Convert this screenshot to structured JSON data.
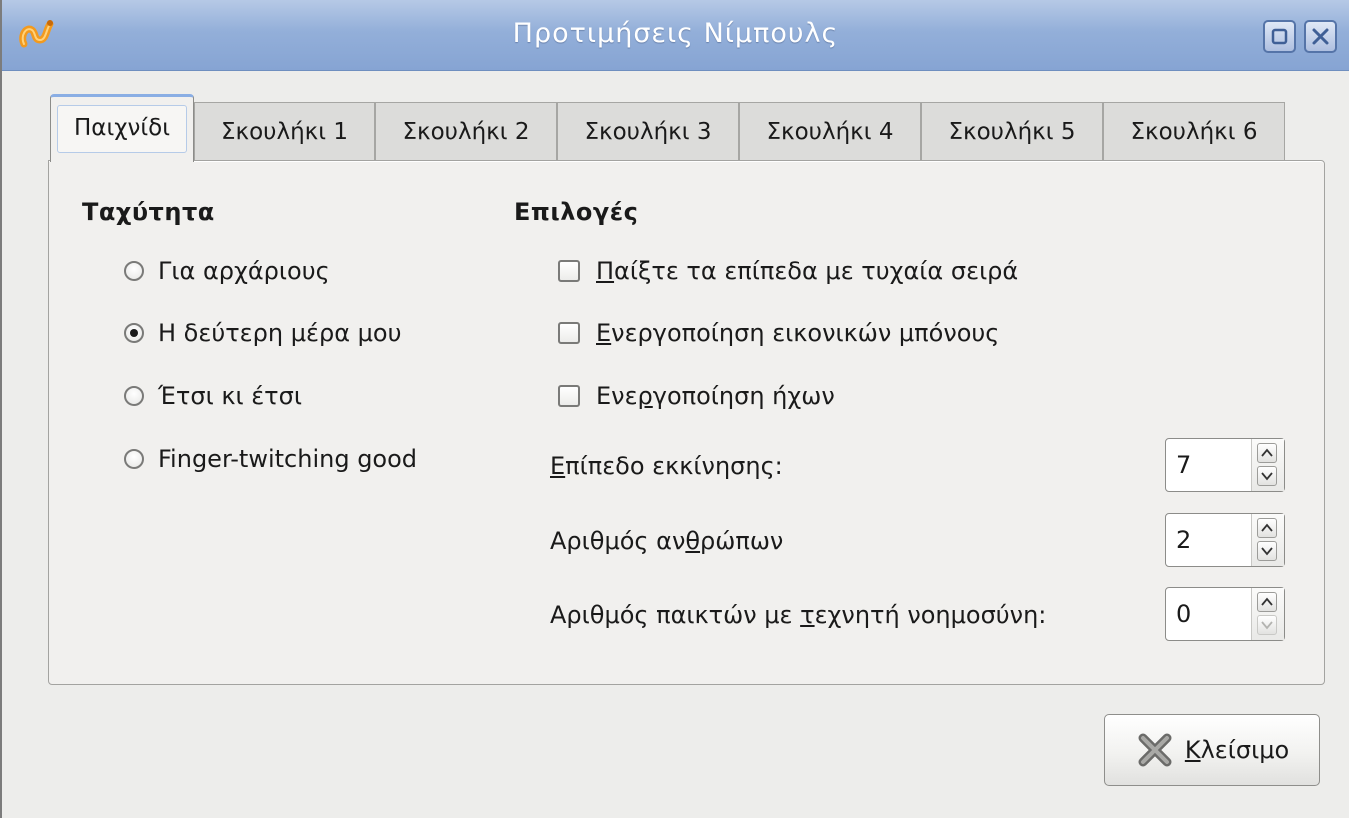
{
  "window": {
    "title": "Προτιμήσεις Νίμπουλς",
    "title_bar_color": "#93afd9"
  },
  "tabs": [
    {
      "label": "Παιχνίδι",
      "active": true
    },
    {
      "label": "Σκουλήκι 1",
      "active": false
    },
    {
      "label": "Σκουλήκι 2",
      "active": false
    },
    {
      "label": "Σκουλήκι 3",
      "active": false
    },
    {
      "label": "Σκουλήκι 4",
      "active": false
    },
    {
      "label": "Σκουλήκι 5",
      "active": false
    },
    {
      "label": "Σκουλήκι 6",
      "active": false
    }
  ],
  "speed": {
    "title": "Ταχύτητα",
    "options": [
      {
        "label": "Για αρχάριους",
        "selected": false
      },
      {
        "label": "Η δεύτερη μέρα μου",
        "selected": true
      },
      {
        "label": "Έτσι κι έτσι",
        "selected": false
      },
      {
        "label": "Finger-twitching good",
        "selected": false
      }
    ]
  },
  "options": {
    "title": "Επιλογές",
    "random_levels": {
      "mnemonic": "Π",
      "rest": "αίξτε τα επίπεδα με τυχαία σειρά",
      "checked": false
    },
    "fake_bonuses": {
      "mnemonic": "Ε",
      "rest": "νεργοποίηση εικονικών μπόνους",
      "checked": false
    },
    "sounds": {
      "before": "Ενε",
      "mnemonic": "ρ",
      "after": "γοποίηση ήχων",
      "checked": false
    },
    "starting_level": {
      "mnemonic": "Ε",
      "rest": "πίπεδο εκκίνησης:",
      "value": "7"
    },
    "human_players": {
      "before": "Αριθμός αν",
      "mnemonic": "θ",
      "after": "ρώπων",
      "value": "2"
    },
    "ai_players": {
      "before": "Αριθμός παικτών με ",
      "mnemonic": "τ",
      "after": "εχνητή νοημοσύνη:",
      "value": "0"
    }
  },
  "close_button": {
    "mnemonic": "Κ",
    "rest": "λείσιμο"
  }
}
